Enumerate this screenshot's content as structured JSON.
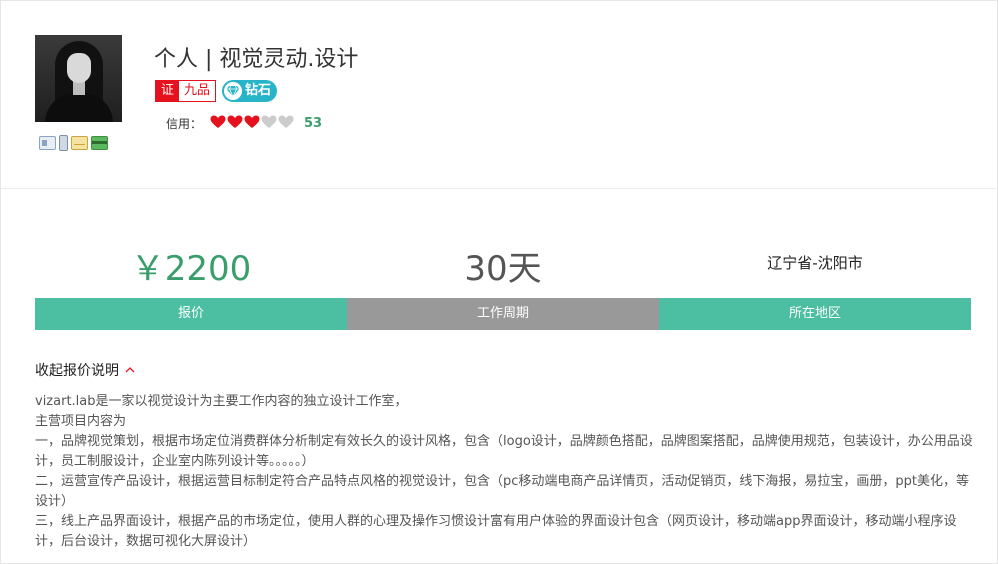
{
  "profile": {
    "name": "个人 | 视觉灵动.设计",
    "cert_tag": "证",
    "cert_level": "九品",
    "diamond_label": "钻石",
    "credit_label": "信用：",
    "credit_score": "53",
    "credit_hearts_filled": 3,
    "credit_hearts_total": 5,
    "verify_icons": [
      "id-card-icon",
      "phone-icon",
      "mail-icon",
      "bank-card-icon"
    ]
  },
  "stats": {
    "price_value": "￥2200",
    "price_label": "报价",
    "period_value": "30天",
    "period_label": "工作周期",
    "region_value": "辽宁省-沈阳市",
    "region_label": "所在地区"
  },
  "description": {
    "toggle_label": "收起报价说明",
    "lines": [
      "vizart.lab是一家以视觉设计为主要工作内容的独立设计工作室，",
      "主营项目内容为",
      "一，品牌视觉策划，根据市场定位消费群体分析制定有效长久的设计风格，包含（logo设计，品牌颜色搭配，品牌图案搭配，品牌使用规范，包装设计，办公用品设计，员工制服设计，企业室内陈列设计等。。。。。）",
      "二，运营宣传产品设计，根据运营目标制定符合产品特点风格的视觉设计，包含（pc移动端电商产品详情页，活动促销页，线下海报，易拉宝，画册，ppt美化，等设计）",
      "三，线上产品界面设计，根据产品的市场定位，使用人群的心理及操作习惯设计富有用户体验的界面设计包含（网页设计，移动端app界面设计，移动端小程序设计，后台设计，数据可视化大屏设计）"
    ]
  },
  "colors": {
    "accent_green": "#4cbea1",
    "price_green": "#3a9d6c",
    "cert_red": "#e5121d",
    "diamond_blue": "#27b3c8",
    "heart_red": "#e5121d",
    "heart_gray": "#cccccc"
  }
}
